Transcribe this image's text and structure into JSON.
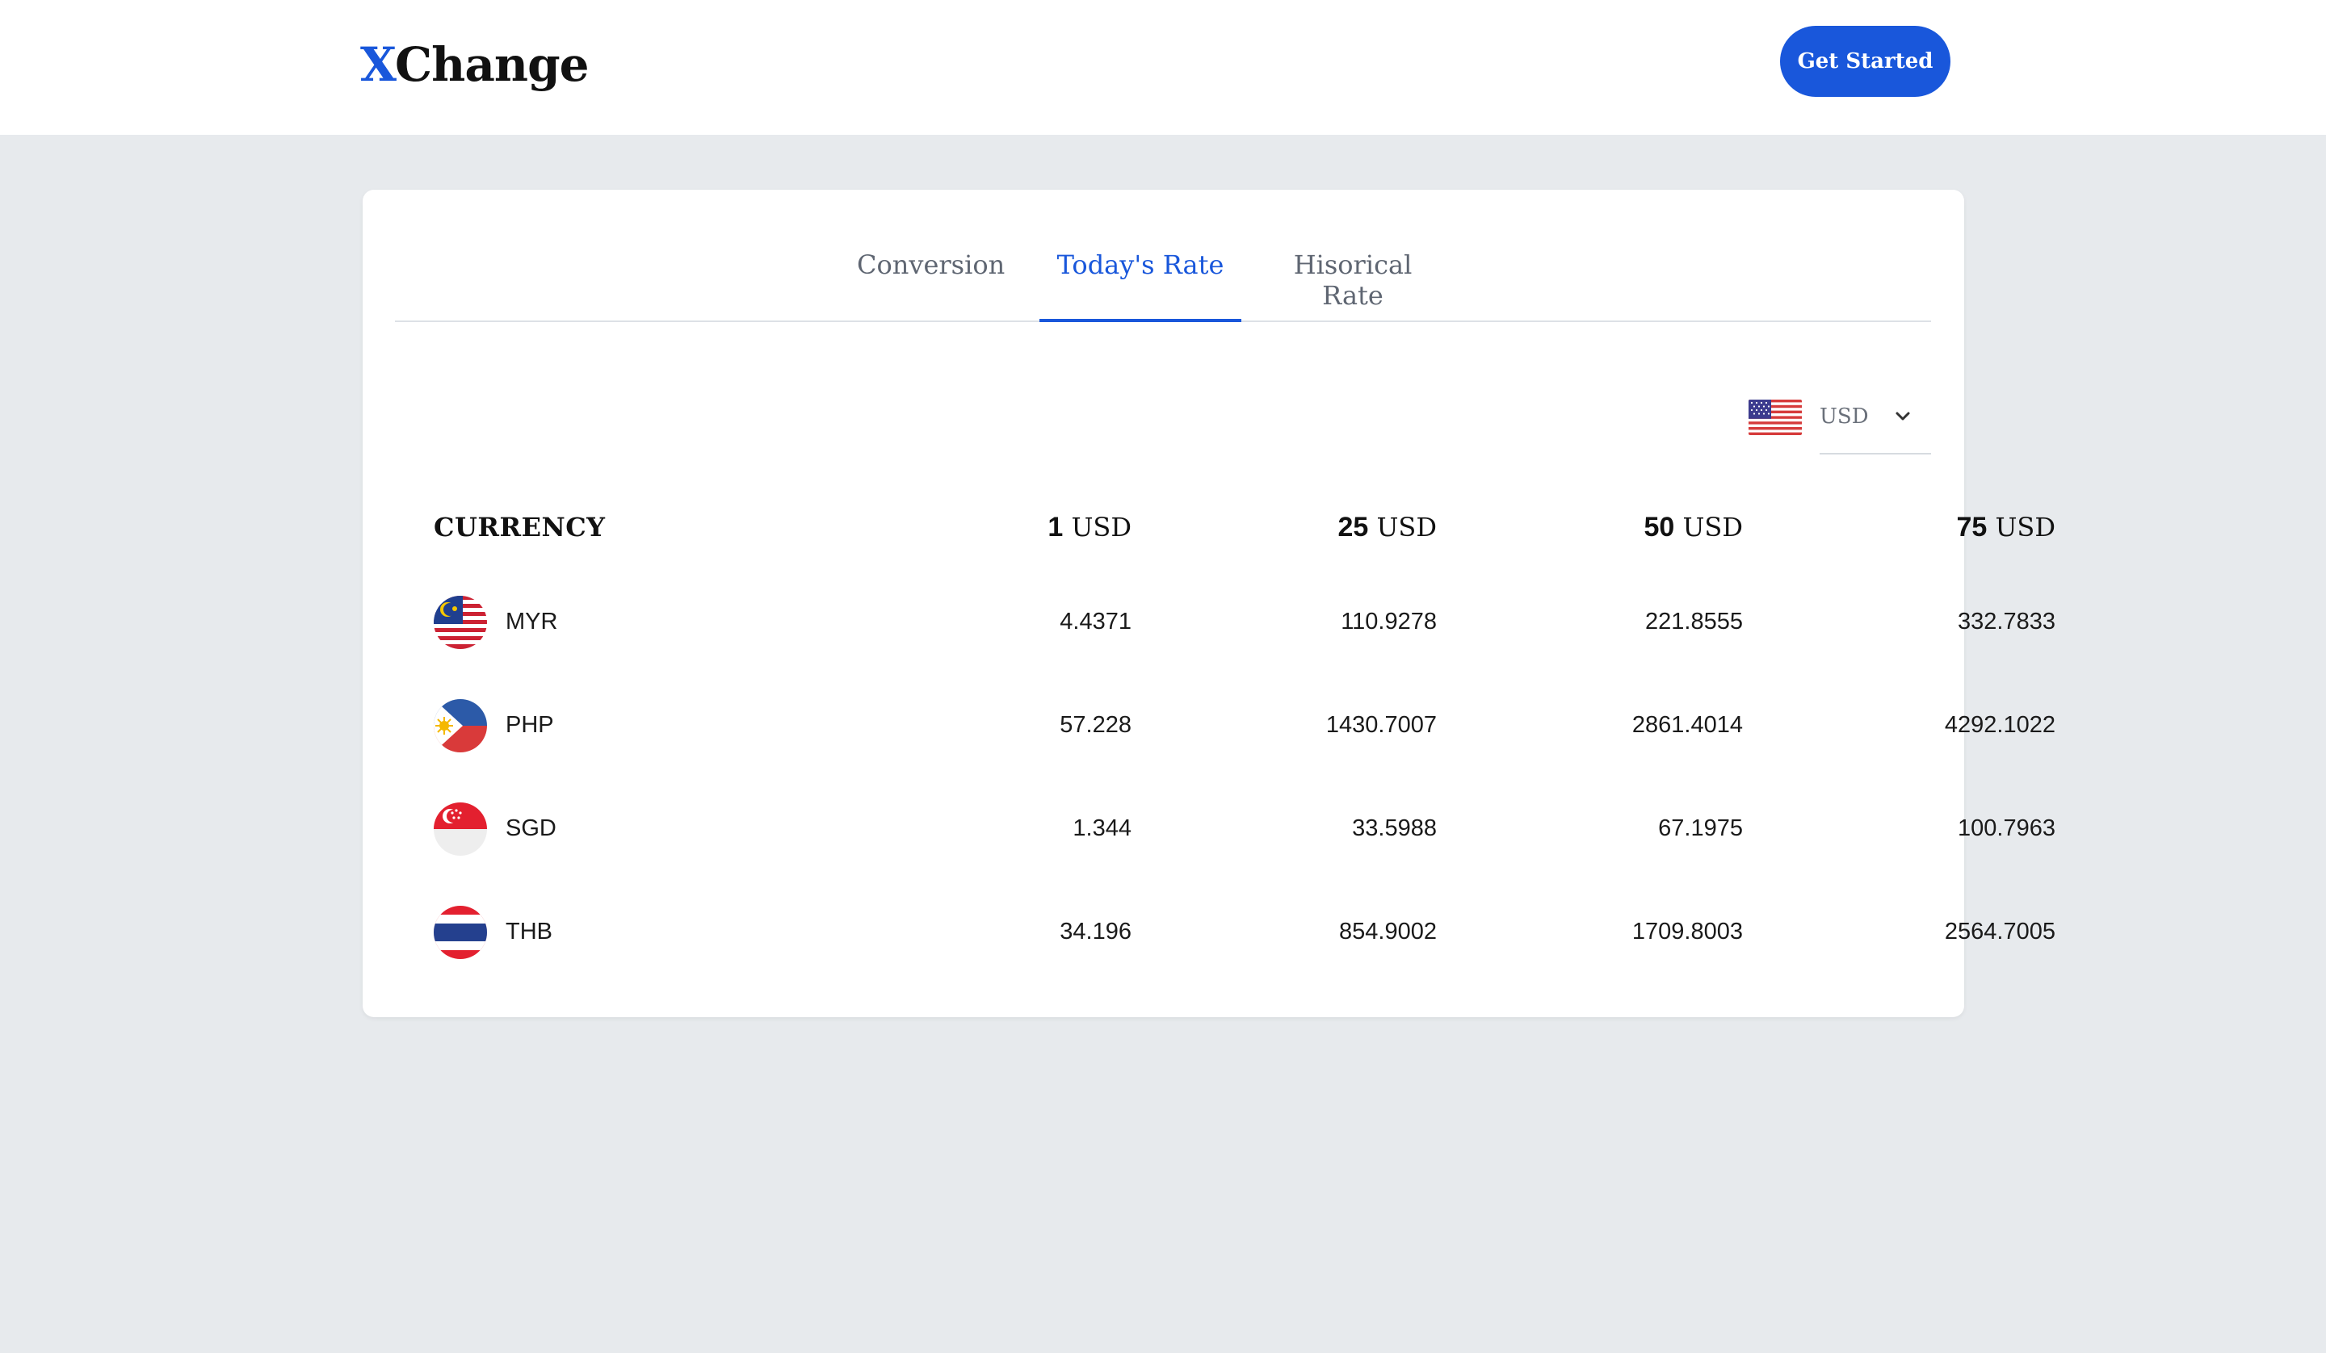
{
  "header": {
    "logo_x": "X",
    "logo_rest": "Change",
    "cta_label": "Get Started"
  },
  "tabs": [
    {
      "label": "Conversion",
      "active": false
    },
    {
      "label": "Today's Rate",
      "active": true
    },
    {
      "label": "Hisorical Rate",
      "active": false
    }
  ],
  "base_currency": {
    "code": "USD",
    "flag_icon": "us-flag-icon"
  },
  "table": {
    "headers": [
      {
        "amount": "",
        "unit": "CURRENCY"
      },
      {
        "amount": "1",
        "unit": " USD"
      },
      {
        "amount": "25",
        "unit": " USD"
      },
      {
        "amount": "50",
        "unit": " USD"
      },
      {
        "amount": "75",
        "unit": " USD"
      }
    ],
    "rows": [
      {
        "code": "MYR",
        "flag_icon": "malaysia-flag-icon",
        "values": [
          "4.4371",
          "110.9278",
          "221.8555",
          "332.7833"
        ]
      },
      {
        "code": "PHP",
        "flag_icon": "philippines-flag-icon",
        "values": [
          "57.228",
          "1430.7007",
          "2861.4014",
          "4292.1022"
        ]
      },
      {
        "code": "SGD",
        "flag_icon": "singapore-flag-icon",
        "values": [
          "1.344",
          "33.5988",
          "67.1975",
          "100.7963"
        ]
      },
      {
        "code": "THB",
        "flag_icon": "thailand-flag-icon",
        "values": [
          "34.196",
          "854.9002",
          "1709.8003",
          "2564.7005"
        ]
      }
    ]
  },
  "colors": {
    "accent": "#1957db",
    "page_bg": "#e7eaed",
    "card_bg": "#ffffff"
  }
}
